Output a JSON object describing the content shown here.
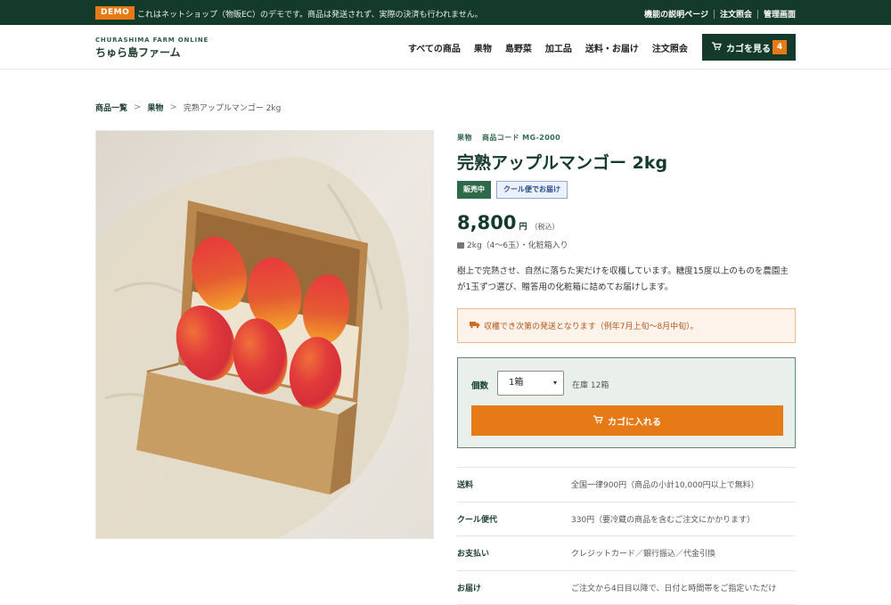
{
  "topbar": {
    "demo_badge": "DEMO",
    "demo_text": "これはネットショップ（物販EC）のデモです。商品は発送されず、実際の決済も行われません。",
    "links": [
      "機能の説明ページ",
      "注文照会",
      "管理画面"
    ]
  },
  "header": {
    "brand_sub": "CHURASHIMA FARM ONLINE",
    "brand_name": "ちゅら島ファーム",
    "nav": [
      "すべての商品",
      "果物",
      "島野菜",
      "加工品",
      "送料・お届け",
      "注文照会"
    ],
    "cart_label": "カゴを見る",
    "cart_count": "4"
  },
  "breadcrumb": {
    "items": [
      "商品一覧",
      "果物"
    ],
    "current": "完熟アップルマンゴー 2kg",
    "separator": ">"
  },
  "product": {
    "category": "果物",
    "code": "商品コード MG-2000",
    "title": "完熟アップルマンゴー 2kg",
    "badge_sale": "販売中",
    "badge_cool": "クール便でお届け",
    "price": "8,800",
    "price_unit": "円",
    "price_tax": "（税込）",
    "spec": "2kg（4〜6玉）・化粧箱入り",
    "description": "樹上で完熟させ、自然に落ちた実だけを収穫しています。糖度15度以上のものを農園主が1玉ずつ選び、贈答用の化粧箱に詰めてお届けします。",
    "notice": "収穫でき次第の発送となります（例年7月上旬〜8月中旬）。"
  },
  "buy": {
    "qty_label": "個数",
    "qty_value": "1箱",
    "stock": "在庫 12箱",
    "add_button": "カゴに入れる"
  },
  "info": [
    {
      "k": "送料",
      "v": "全国一律900円（商品の小計10,000円以上で無料）"
    },
    {
      "k": "クール便代",
      "v": "330円（要冷蔵の商品を含むご注文にかかります）"
    },
    {
      "k": "お支払い",
      "v": "クレジットカード／銀行振込／代金引換"
    },
    {
      "k": "お届け",
      "v": "ご注文から4日目以降で、日付と時間帯をご指定いただけ"
    }
  ],
  "colors": {
    "dark_green": "#143a2b",
    "accent_orange": "#e67a16",
    "notice_bg": "#fdf3ea",
    "buy_box_bg": "#e9f0ec"
  }
}
